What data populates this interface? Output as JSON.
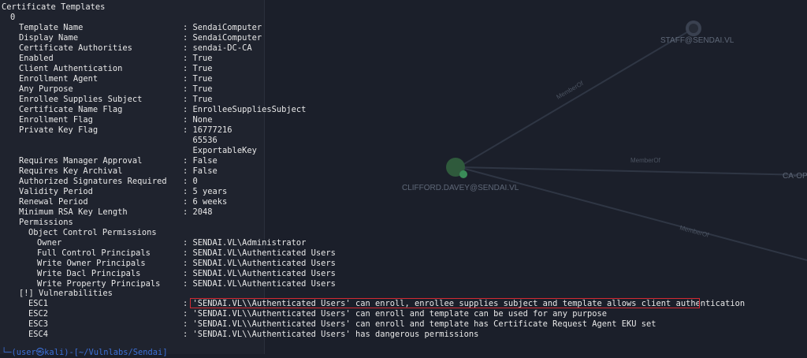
{
  "graph": {
    "nodes": [
      {
        "label": "STAFF@SENDAI.VL"
      },
      {
        "label": "CLIFFORD.DAVEY@SENDAI.VL"
      },
      {
        "label": "CA-OP"
      }
    ],
    "edges": [
      {
        "label": "MemberOf"
      },
      {
        "label": "MemberOf"
      },
      {
        "label": "MemberOf"
      }
    ]
  },
  "terminal": {
    "title": "Certificate Templates",
    "index": "0",
    "fields": [
      {
        "key": "Template Name",
        "value": ": SendaiComputer"
      },
      {
        "key": "Display Name",
        "value": ": SendaiComputer"
      },
      {
        "key": "Certificate Authorities",
        "value": ": sendai-DC-CA"
      },
      {
        "key": "Enabled",
        "value": ": True"
      },
      {
        "key": "Client Authentication",
        "value": ": True"
      },
      {
        "key": "Enrollment Agent",
        "value": ": True"
      },
      {
        "key": "Any Purpose",
        "value": ": True"
      },
      {
        "key": "Enrollee Supplies Subject",
        "value": ": True"
      },
      {
        "key": "Certificate Name Flag",
        "value": ": EnrolleeSuppliesSubject"
      },
      {
        "key": "Enrollment Flag",
        "value": ": None"
      },
      {
        "key": "Private Key Flag",
        "value": ": 16777216"
      },
      {
        "key": "",
        "value": "  65536"
      },
      {
        "key": "",
        "value": "  ExportableKey"
      },
      {
        "key": "Requires Manager Approval",
        "value": ": False"
      },
      {
        "key": "Requires Key Archival",
        "value": ": False"
      },
      {
        "key": "Authorized Signatures Required",
        "value": ": 0"
      },
      {
        "key": "Validity Period",
        "value": ": 5 years"
      },
      {
        "key": "Renewal Period",
        "value": ": 6 weeks"
      },
      {
        "key": "Minimum RSA Key Length",
        "value": ": 2048"
      }
    ],
    "permissions_label": "Permissions",
    "ocp_label": "Object Control Permissions",
    "permissions": [
      {
        "key": "Owner",
        "value": ": SENDAI.VL\\Administrator"
      },
      {
        "key": "Full Control Principals",
        "value": ": SENDAI.VL\\Authenticated Users"
      },
      {
        "key": "Write Owner Principals",
        "value": ": SENDAI.VL\\Authenticated Users"
      },
      {
        "key": "Write Dacl Principals",
        "value": ": SENDAI.VL\\Authenticated Users"
      },
      {
        "key": "Write Property Principals",
        "value": ": SENDAI.VL\\Authenticated Users"
      }
    ],
    "vuln_label": "[!] Vulnerabilities",
    "vulnerabilities": [
      {
        "key": "ESC1",
        "value": ": 'SENDAI.VL\\\\Authenticated Users' can enroll, enrollee supplies subject and template allows client authentication"
      },
      {
        "key": "ESC2",
        "value": ": 'SENDAI.VL\\\\Authenticated Users' can enroll and template can be used for any purpose"
      },
      {
        "key": "ESC3",
        "value": ": 'SENDAI.VL\\\\Authenticated Users' can enroll and template has Certificate Request Agent EKU set"
      },
      {
        "key": "ESC4",
        "value": ": 'SENDAI.VL\\\\Authenticated Users' has dangerous permissions"
      }
    ],
    "prompt": "└─(user㉿kali)-[~/Vulnlabs/Sendai]"
  }
}
